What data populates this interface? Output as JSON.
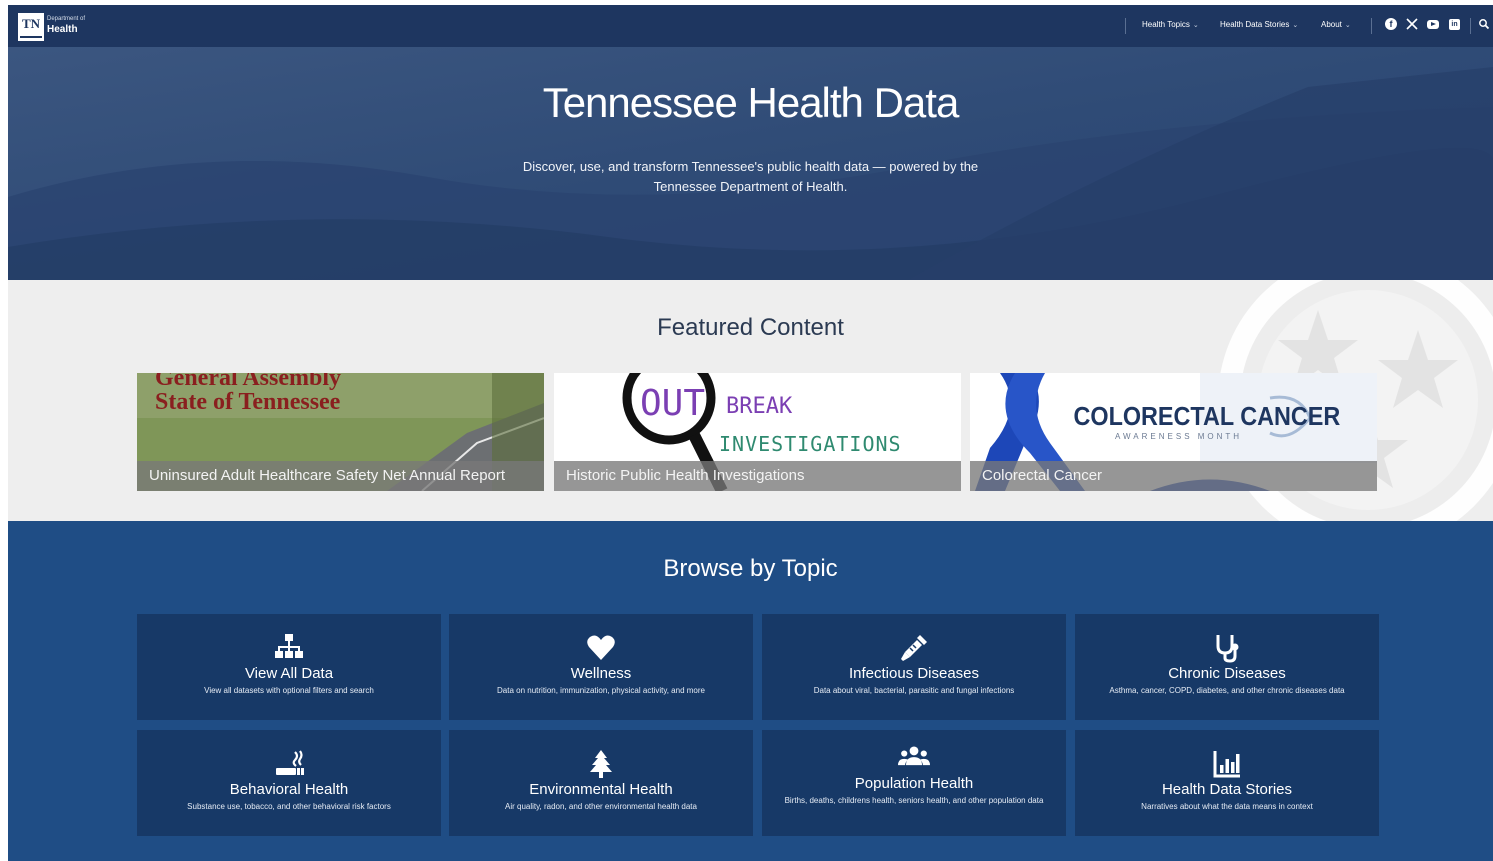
{
  "header": {
    "logo": {
      "tn": "TN",
      "department": "Department of",
      "health": "Health"
    },
    "nav": [
      {
        "label": "Health Topics"
      },
      {
        "label": "Health Data Stories"
      },
      {
        "label": "About"
      }
    ],
    "social_icons": [
      "facebook-icon",
      "x-icon",
      "youtube-icon",
      "linkedin-icon"
    ],
    "search_icon": "search-icon"
  },
  "hero": {
    "title": "Tennessee Health Data",
    "subtitle": "Discover, use, and transform Tennessee's public health data — powered by the Tennessee Department of Health."
  },
  "featured": {
    "title": "Featured Content",
    "cards": [
      {
        "image_text_1": "General Assembly",
        "image_text_2": "State of Tennessee",
        "caption": "Uninsured Adult Healthcare Safety Net Annual Report"
      },
      {
        "image_text_1": "OUT",
        "image_text_2": "BREAK",
        "image_text_3": "INVESTIGATIONS",
        "caption": "Historic Public Health Investigations"
      },
      {
        "image_text_1": "COLORECTAL CANCER",
        "image_text_2": "AWARENESS MONTH",
        "caption": "Colorectal Cancer"
      }
    ]
  },
  "browse": {
    "title": "Browse by Topic",
    "tiles": [
      {
        "title": "View All Data",
        "desc": "View all datasets with optional filters and search",
        "icon": "sitemap-icon"
      },
      {
        "title": "Wellness",
        "desc": "Data on nutrition, immunization, physical activity, and more",
        "icon": "heart-icon"
      },
      {
        "title": "Infectious Diseases",
        "desc": "Data about viral, bacterial, parasitic and fungal infections",
        "icon": "syringe-icon"
      },
      {
        "title": "Chronic Diseases",
        "desc": "Asthma, cancer, COPD, diabetes, and other chronic diseases data",
        "icon": "stethoscope-icon"
      },
      {
        "title": "Behavioral Health",
        "desc": "Substance use, tobacco, and other behavioral risk factors",
        "icon": "smoking-icon"
      },
      {
        "title": "Environmental Health",
        "desc": "Air quality, radon, and other environmental health data",
        "icon": "tree-icon"
      },
      {
        "title": "Population Health",
        "desc": "Births, deaths, childrens health, seniors health, and other population data",
        "icon": "people-icon"
      },
      {
        "title": "Health Data Stories",
        "desc": "Narratives about what the data means in context",
        "icon": "bar-chart-icon"
      }
    ]
  },
  "colors": {
    "nav_bg": "#1e3660",
    "hero_bg": "#2e4a74",
    "featured_bg": "#eeeeee",
    "browse_bg": "#1f4d85",
    "tile_bg": "#173967",
    "accent_purple": "#7b3fb3",
    "ribbon_blue": "#1d47b8"
  }
}
